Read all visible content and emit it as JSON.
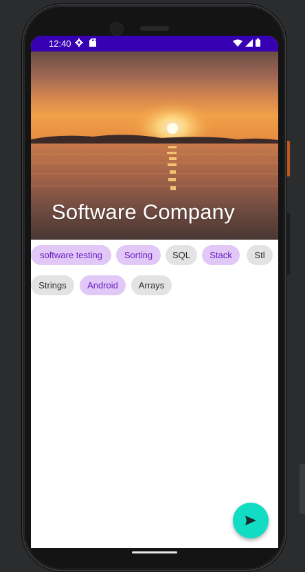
{
  "status_bar": {
    "time": "12:40",
    "background": "#3700b3",
    "left_icons": [
      "gear-icon",
      "sd-card-icon"
    ],
    "right_icons": [
      "wifi-icon",
      "signal-icon",
      "battery-icon"
    ]
  },
  "hero": {
    "title": "Software Company",
    "image": "sunset over water"
  },
  "chips": [
    {
      "label": "software testing",
      "selected": true
    },
    {
      "label": "Sorting",
      "selected": true
    },
    {
      "label": "SQL",
      "selected": false
    },
    {
      "label": "Stack",
      "selected": true
    },
    {
      "label": "Stl",
      "selected": false
    },
    {
      "label": "Strings",
      "selected": false
    },
    {
      "label": "Android",
      "selected": true
    },
    {
      "label": "Arrays",
      "selected": false
    }
  ],
  "fab": {
    "icon": "send-icon",
    "color": "#13dcc5"
  },
  "colors": {
    "chip_selected_bg": "#e1c8f7",
    "chip_selected_text": "#6a1cc5",
    "chip_plain_bg": "#e3e3e3"
  }
}
